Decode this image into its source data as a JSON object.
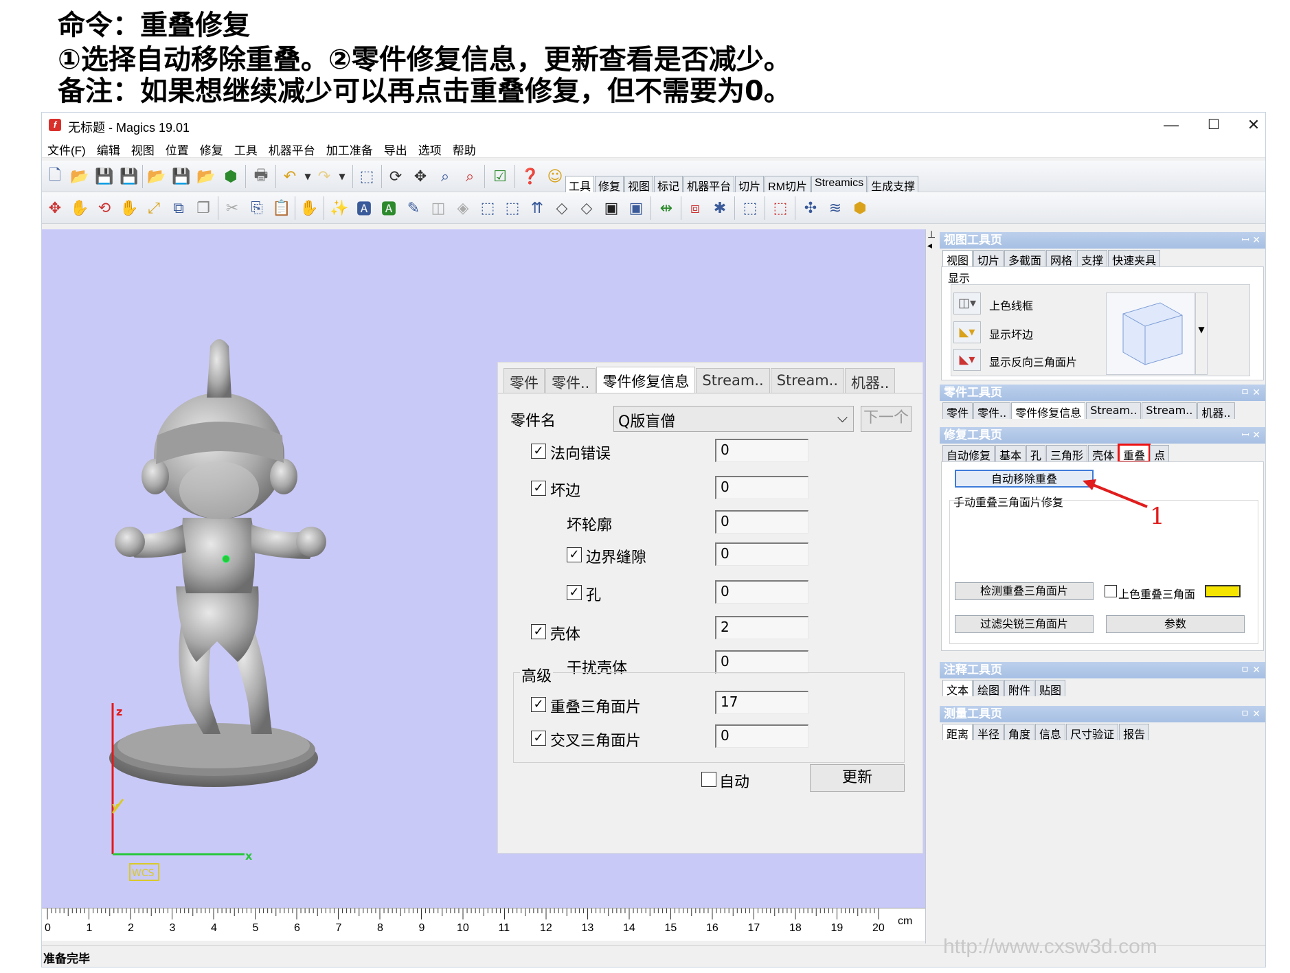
{
  "instructions": {
    "line1": "命令：重叠修复",
    "line2": "①选择自动移除重叠。②零件修复信息，更新查看是否减少。",
    "line3": "备注：如果想继续减少可以再点击重叠修复，但不需要为0。"
  },
  "window": {
    "title": "无标题 - Magics 19.01",
    "minimize": "—",
    "maximize": "☐",
    "close": "✕"
  },
  "menu": [
    "文件(F)",
    "编辑",
    "视图",
    "位置",
    "修复",
    "工具",
    "机器平台",
    "加工准备",
    "导出",
    "选项",
    "帮助"
  ],
  "toolbar_tabs": [
    "工具",
    "修复",
    "视图",
    "标记",
    "机器平台",
    "切片",
    "RM切片",
    "Streamics",
    "生成支撑"
  ],
  "viewport": {
    "axis_z": "z",
    "axis_x": "x",
    "axis_y": "y",
    "wcs_label": "WCS"
  },
  "ruler": {
    "labels": [
      "0",
      "1",
      "2",
      "3",
      "4",
      "5",
      "6",
      "7",
      "8",
      "9",
      "10",
      "11",
      "12",
      "13",
      "14",
      "15",
      "16",
      "17",
      "18",
      "19",
      "20"
    ],
    "unit": "cm"
  },
  "status": {
    "text": "准备完毕"
  },
  "watermark": "http://www.cxsw3d.com",
  "dialog": {
    "tabs": [
      "零件",
      "零件..",
      "零件修复信息",
      "Stream..",
      "Stream..",
      "机器.."
    ],
    "part_name_label": "零件名",
    "part_name_value": "Q版盲僧",
    "next_button": "下一个",
    "rows": {
      "normal_error": {
        "label": "法向错误",
        "value": "0",
        "checked": true
      },
      "bad_edges": {
        "label": "坏边",
        "value": "0",
        "checked": true
      },
      "bad_contours": {
        "label": "坏轮廓",
        "value": "0"
      },
      "border_gaps": {
        "label": "边界缝隙",
        "value": "0",
        "checked": true
      },
      "holes": {
        "label": "孔",
        "value": "0",
        "checked": true
      },
      "shells": {
        "label": "壳体",
        "value": "2",
        "checked": true
      },
      "noise_shells": {
        "label": "干扰壳体",
        "value": "0"
      },
      "overlapping": {
        "label": "重叠三角面片",
        "value": "17",
        "checked": true
      },
      "intersecting": {
        "label": "交叉三角面片",
        "value": "0",
        "checked": true
      }
    },
    "advanced_label": "高级",
    "auto_label": "自动",
    "update_button": "更新"
  },
  "panels": {
    "view": {
      "title": "视图工具页",
      "tabs": [
        "视图",
        "切片",
        "多截面",
        "网格",
        "支撑",
        "快速夹具"
      ],
      "group": "显示",
      "items": [
        "上色线框",
        "显示坏边",
        "显示反向三角面片"
      ]
    },
    "part": {
      "title": "零件工具页",
      "tabs": [
        "零件",
        "零件..",
        "零件修复信息",
        "Stream..",
        "Stream..",
        "机器.."
      ]
    },
    "repair": {
      "title": "修复工具页",
      "tabs": [
        "自动修复",
        "基本",
        "孔",
        "三角形",
        "壳体",
        "重叠",
        "点"
      ],
      "auto_remove": "自动移除重叠",
      "manual_group": "手动重叠三角面片修复",
      "detect_button": "检测重叠三角面片",
      "color_label": "上色重叠三角面",
      "filter_button": "过滤尖锐三角面片",
      "params_button": "参数",
      "highlight_color": "#f4e400"
    },
    "annotation": {
      "title": "注释工具页",
      "tabs": [
        "文本",
        "绘图",
        "附件",
        "贴图"
      ]
    },
    "measure": {
      "title": "测量工具页",
      "tabs": [
        "距离",
        "半径",
        "角度",
        "信息",
        "尺寸验证",
        "报告"
      ]
    },
    "controls": "ㅁ ✕",
    "controls_pin": "ꟷ ✕"
  },
  "annotation": {
    "step_number": "1",
    "color": "#e11d1d"
  }
}
